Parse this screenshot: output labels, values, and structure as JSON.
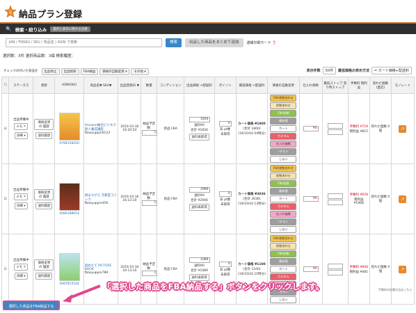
{
  "header": {
    "title": "納品プラン登録"
  },
  "search": {
    "section_label": "検索・絞り込み",
    "toggle_label": "操作と表示に関する注意",
    "placeholder": "JAN / FNSKU / SKU / 商品名 / ASIN で検索",
    "search_button": "検索",
    "bulk_button": "出品した商品をまとめて追加",
    "print_mode": "通報印刷モード ❓"
  },
  "counts": {
    "text": "選択数：3件 選択商品数：3個 検索履歴："
  },
  "filters": [
    "チェックの付いた商品を",
    "出品停止",
    "出品削除",
    "FBA納品",
    "価格の自動変更 ▾",
    "その他 ▾"
  ],
  "controls": {
    "per_page_label": "表示件数",
    "per_page_value": "50件",
    "price_label": "最低価格の表示方法",
    "price_value": "= カート価格+配送料"
  },
  "columns": [
    "☐",
    "ステータス",
    "更新",
    "ASIN/SKU",
    "商品名▼ SKU▼",
    "出品登録日 ▼",
    "数量",
    "コンディション",
    "出品価格 +配送料",
    "ポイント",
    "最低価格 +配送料",
    "価格の自動変更",
    "仕入れ価格",
    "最低ストップ 売り時ストップ",
    "手数料 粗利益",
    "売れた個数(直近)",
    "モノレート"
  ],
  "rows": [
    {
      "status": "出品準備中",
      "memo": "メモ ✎",
      "detail": "詳細 ▾",
      "history_btn": "価格変更の 履歴",
      "ship_btn": "送料履歴",
      "asin": "4798158350",
      "title": "Amazon輸出ビジネス達人養成講座",
      "sku": "fbasyuppin0123",
      "date": "2019-10-16 16:20:54",
      "qty_label": "納品予定数:",
      "qty": "1",
      "condition": "新品 FBA",
      "price": "1834",
      "ship": "送料¥0",
      "total": "合計 ¥1834",
      "ship_btn2": "送料再取得",
      "points": "0",
      "pts_label": "非 pt数",
      "calc": "未取得",
      "fee": "手数料 ¥719",
      "profit": "粗利益 ¥815",
      "cart": "カート価格 ¥1800",
      "min_total": "(合計 1800)",
      "low": "(19/10/16 04時分)",
      "buy": "¥0",
      "sold": "売れた個数 0個"
    },
    {
      "status": "出品準備中",
      "memo": "メモ ✎",
      "detail": "詳細 ▾",
      "history_btn": "価格変更の 履歴",
      "ship_btn": "送料履歴",
      "asin": "4086188654",
      "title": "顔まちがえ 元教室コミック",
      "sku": "fbasyuppin456",
      "date": "2019-10-16 16:13:10",
      "qty_label": "納品予定数:",
      "qty": "1",
      "condition": "新品 FBA",
      "price": "2946",
      "ship": "送料¥0",
      "total": "合計 ¥2946",
      "ship_btn2": "送料再取得",
      "points": "0",
      "pts_label": "非 pt数",
      "calc": "未取得",
      "fee": "手数料 ¥978",
      "profit": "粗利益 ¥1968",
      "cart": "カート価格 ¥3036",
      "min_total": "(合計 3036)",
      "low": "(19/10/16 13時分)",
      "buy": "¥0",
      "sold": "売れた個数 0個"
    },
    {
      "status": "出品準備中",
      "memo": "メモ ✎",
      "detail": "詳細 ▾",
      "history_btn": "価格変更の 履歴",
      "ship_btn": "送料履歴",
      "asin": "4087815544",
      "title": "読めたて PICTURE BOOK",
      "sku": "fbasyuppin789",
      "date": "2019-10-16 16:13:10",
      "qty_label": "納品予定数:",
      "qty": "1",
      "condition": "新品 FBA",
      "price": "1089",
      "ship": "送料¥0",
      "total": "合計 ¥1089",
      "ship_btn2": "送料再取得",
      "points": "0",
      "pts_label": "非 pt数",
      "calc": "未取得",
      "fee": "手数料 ¥608",
      "profit": "粗利益 ¥481",
      "cart": "カート価格 ¥1100",
      "min_total": "(合計 1100)",
      "low": "(19/10/16 15時分)",
      "buy": "¥0",
      "sold": "売れた個数 0個"
    }
  ],
  "price_buttons": [
    "FBA状態合わせ",
    "状態合わせ",
    "FBA状態",
    "最安値",
    "カート",
    "カスタム",
    "仕入れ価格",
    "rテスト",
    "しない"
  ],
  "footer": {
    "bulk_fba_button": "選択した商品をFBA納品する",
    "callout": "「選択した商品をFBA納品する」ボタンをクリックします。",
    "note": "手数料の計算方法はこちら"
  }
}
